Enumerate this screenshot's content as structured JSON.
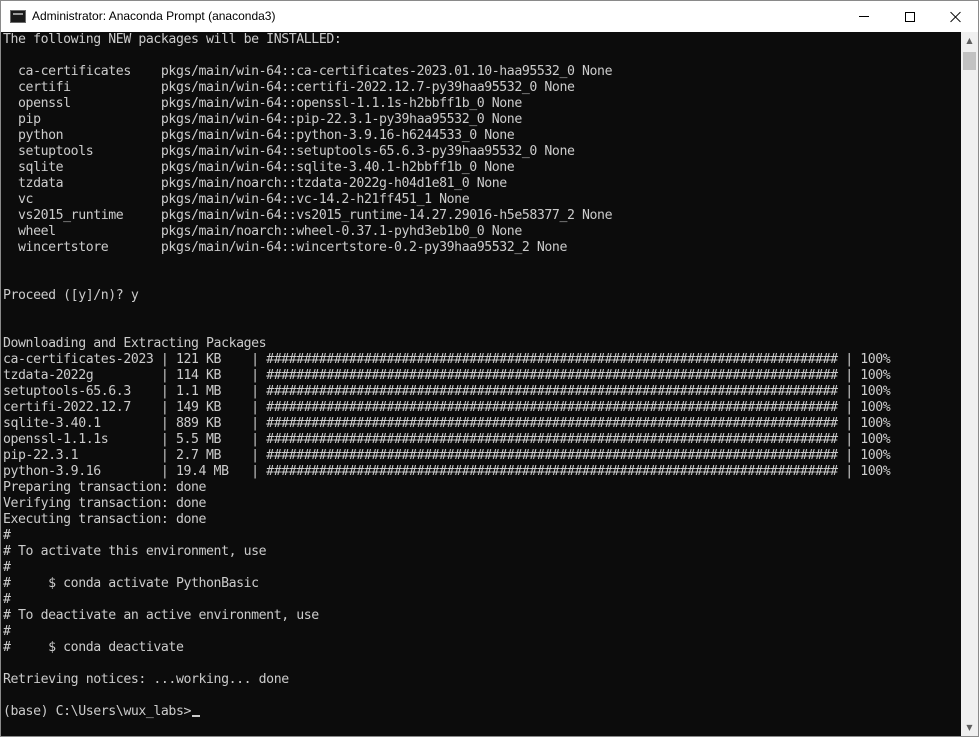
{
  "window": {
    "title": "Administrator: Anaconda Prompt (anaconda3)",
    "controls": {
      "minimize": "minimize",
      "maximize": "maximize",
      "close": "close"
    }
  },
  "console": {
    "lines": [
      "The following NEW packages will be INSTALLED:",
      "",
      "  ca-certificates    pkgs/main/win-64::ca-certificates-2023.01.10-haa95532_0 None",
      "  certifi            pkgs/main/win-64::certifi-2022.12.7-py39haa95532_0 None",
      "  openssl            pkgs/main/win-64::openssl-1.1.1s-h2bbff1b_0 None",
      "  pip                pkgs/main/win-64::pip-22.3.1-py39haa95532_0 None",
      "  python             pkgs/main/win-64::python-3.9.16-h6244533_0 None",
      "  setuptools         pkgs/main/win-64::setuptools-65.6.3-py39haa95532_0 None",
      "  sqlite             pkgs/main/win-64::sqlite-3.40.1-h2bbff1b_0 None",
      "  tzdata             pkgs/main/noarch::tzdata-2022g-h04d1e81_0 None",
      "  vc                 pkgs/main/win-64::vc-14.2-h21ff451_1 None",
      "  vs2015_runtime     pkgs/main/win-64::vs2015_runtime-14.27.29016-h5e58377_2 None",
      "  wheel              pkgs/main/noarch::wheel-0.37.1-pyhd3eb1b0_0 None",
      "  wincertstore       pkgs/main/win-64::wincertstore-0.2-py39haa95532_2 None",
      "",
      "",
      "Proceed ([y]/n)? y",
      "",
      "",
      "Downloading and Extracting Packages",
      "ca-certificates-2023 | 121 KB    | ############################################################################ | 100%",
      "tzdata-2022g         | 114 KB    | ############################################################################ | 100%",
      "setuptools-65.6.3    | 1.1 MB    | ############################################################################ | 100%",
      "certifi-2022.12.7    | 149 KB    | ############################################################################ | 100%",
      "sqlite-3.40.1        | 889 KB    | ############################################################################ | 100%",
      "openssl-1.1.1s       | 5.5 MB    | ############################################################################ | 100%",
      "pip-22.3.1           | 2.7 MB    | ############################################################################ | 100%",
      "python-3.9.16        | 19.4 MB   | ############################################################################ | 100%",
      "Preparing transaction: done",
      "Verifying transaction: done",
      "Executing transaction: done",
      "#",
      "# To activate this environment, use",
      "#",
      "#     $ conda activate PythonBasic",
      "#",
      "# To deactivate an active environment, use",
      "#",
      "#     $ conda deactivate",
      "",
      "Retrieving notices: ...working... done",
      ""
    ],
    "prompt": "(base) C:\\Users\\wux_labs>"
  },
  "colors": {
    "console_bg": "#0c0c0c",
    "console_fg": "#cccccc",
    "titlebar_bg": "#ffffff",
    "scrollbar_bg": "#f0f0f0"
  },
  "icons": {
    "app": "console-icon",
    "scroll_up": "chevron-up-icon",
    "scroll_down": "chevron-down-icon"
  }
}
